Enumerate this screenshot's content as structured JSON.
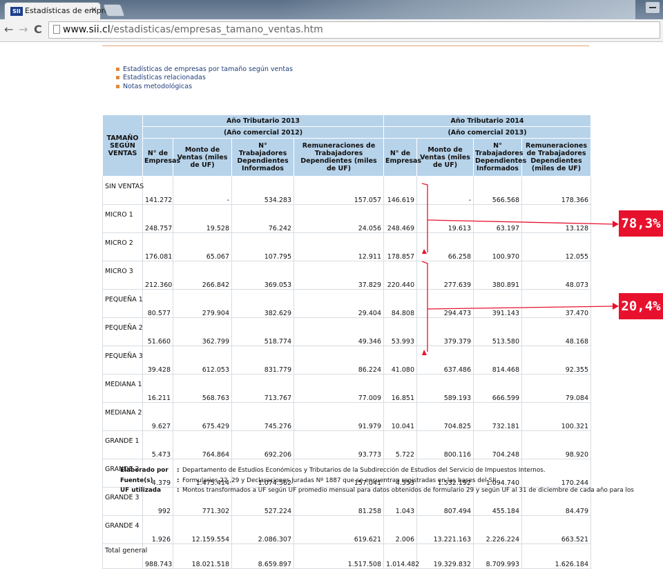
{
  "browser": {
    "tab_title": "Estadísticas de empresa",
    "tab_close": "×",
    "favicon_text": "SII",
    "url_host": "www.sii.cl",
    "url_path": "/estadisticas/empresas_tamano_ventas.htm",
    "back_glyph": "←",
    "forward_glyph": "→",
    "reload_glyph": "C"
  },
  "links": [
    "Estadísticas de empresas por tamaño según ventas",
    "Estadísticas relacionadas",
    "Notas metodológicas"
  ],
  "table": {
    "row_header": "TAMAÑO SEGÚN VENTAS",
    "groups": [
      {
        "year": "Año Tributario 2013",
        "commercial": "(Año comercial 2012)"
      },
      {
        "year": "Año Tributario 2014",
        "commercial": "(Año comercial 2013)"
      }
    ],
    "columns_2013": [
      "N° de Empresas",
      "Monto de Ventas (miles de UF)",
      "N° Trabajadores Dependientes Informados",
      "Remuneraciones de Trabajadores Dependientes (miles de UF)"
    ],
    "columns_2014": [
      "N° de Empresas",
      "Monto de Ventas (miles de UF)",
      "N° Trabajadores Dependientes Informados",
      "Remuneraciones de Trabajadores Dependientes (miles de UF)"
    ],
    "rows": [
      {
        "label": "SIN VENTAS",
        "values": [
          "141.272",
          "-",
          "534.283",
          "157.057",
          "146.619",
          "-",
          "566.568",
          "178.366"
        ]
      },
      {
        "label": "MICRO 1",
        "values": [
          "248.757",
          "19.528",
          "76.242",
          "24.056",
          "248.469",
          "19.613",
          "63.197",
          "13.128"
        ]
      },
      {
        "label": "MICRO 2",
        "values": [
          "176.081",
          "65.067",
          "107.795",
          "12.911",
          "178.857",
          "66.258",
          "100.970",
          "12.055"
        ]
      },
      {
        "label": "MICRO 3",
        "values": [
          "212.360",
          "266.842",
          "369.053",
          "37.829",
          "220.440",
          "277.639",
          "380.891",
          "48.073"
        ]
      },
      {
        "label": "PEQUEÑA 1",
        "values": [
          "80.577",
          "279.904",
          "382.629",
          "29.404",
          "84.808",
          "294.473",
          "391.143",
          "37.470"
        ]
      },
      {
        "label": "PEQUEÑA 2",
        "values": [
          "51.660",
          "362.799",
          "518.774",
          "49.346",
          "53.993",
          "379.379",
          "513.580",
          "48.168"
        ]
      },
      {
        "label": "PEQUEÑA 3",
        "values": [
          "39.428",
          "612.053",
          "831.779",
          "86.224",
          "41.080",
          "637.486",
          "814.468",
          "92.355"
        ]
      },
      {
        "label": "MEDIANA 1",
        "values": [
          "16.211",
          "568.763",
          "713.767",
          "77.009",
          "16.851",
          "589.193",
          "666.599",
          "79.084"
        ]
      },
      {
        "label": "MEDIANA 2",
        "values": [
          "9.627",
          "675.429",
          "745.276",
          "91.979",
          "10.041",
          "704.825",
          "732.181",
          "100.321"
        ]
      },
      {
        "label": "GRANDE 1",
        "values": [
          "5.473",
          "764.864",
          "692.206",
          "93.773",
          "5.722",
          "800.116",
          "704.248",
          "98.920"
        ]
      },
      {
        "label": "GRANDE 2",
        "values": [
          "4.379",
          "1.475.414",
          "1.074.562",
          "157.041",
          "4.553",
          "1.532.192",
          "1.094.740",
          "170.244"
        ]
      },
      {
        "label": "GRANDE 3",
        "values": [
          "992",
          "771.302",
          "527.224",
          "81.258",
          "1.043",
          "807.494",
          "455.184",
          "84.479"
        ]
      },
      {
        "label": "GRANDE 4",
        "values": [
          "1.926",
          "12.159.554",
          "2.086.307",
          "619.621",
          "2.006",
          "13.221.163",
          "2.226.224",
          "663.521"
        ]
      }
    ],
    "total": {
      "label": "Total general",
      "values": [
        "988.743",
        "18.021.518",
        "8.659.897",
        "1.517.508",
        "1.014.482",
        "19.329.832",
        "8.709.993",
        "1.626.184"
      ]
    }
  },
  "annotations": [
    {
      "text": "78,3%",
      "color": "#e8112d"
    },
    {
      "text": "20,4%",
      "color": "#e8112d"
    }
  ],
  "footer": [
    {
      "key": "Elaborado por",
      "colon": ":",
      "value": "Departamento de Estudios Económicos y Tributarios de la Subdirección de Estudios del Servicio de Impuestos Internos."
    },
    {
      "key": "Fuente(s)",
      "colon": ":",
      "value": "Formularios 22 ,29 y Declaraciones Juradas Nº 1887 que se encuentran registradas en las bases del SII."
    },
    {
      "key": "UF utilizada",
      "colon": ":",
      "value": "Montos transformados a UF según UF promedio mensual para datos obtenidos de formulario 29 y según UF al 31 de diciembre de cada año para los"
    }
  ]
}
